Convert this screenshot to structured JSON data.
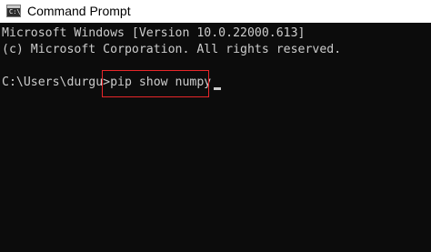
{
  "window": {
    "title": "Command Prompt",
    "icon": "terminal-icon",
    "icon_glyph": "C:\\_"
  },
  "console": {
    "lines": [
      "Microsoft Windows [Version 10.0.22000.613]",
      "(c) Microsoft Corporation. All rights reserved."
    ],
    "prompt": "C:\\Users\\durgu>",
    "command": "pip show numpy"
  },
  "colors": {
    "background": "#0c0c0c",
    "text": "#cccccc",
    "highlight_border": "#e8262a",
    "titlebar": "#ffffff"
  }
}
